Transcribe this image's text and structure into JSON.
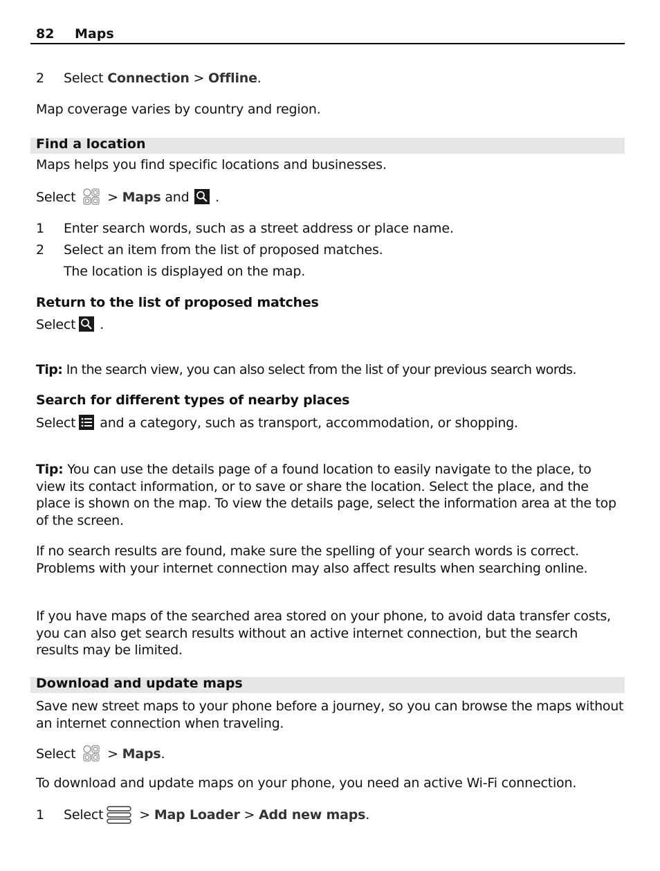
{
  "header": {
    "page_number": "82",
    "chapter": "Maps"
  },
  "step_offline": {
    "num": "2",
    "select": "Select",
    "item1": "Connection",
    "sep": " > ",
    "item2": "Offline",
    "end": "."
  },
  "coverage": "Map coverage varies by country and region.",
  "find_location": {
    "heading": "Find a location",
    "intro": "Maps helps you find specific locations and businesses.",
    "select_line": {
      "select": "Select",
      "sep": " > ",
      "maps": "Maps",
      "and": " and ",
      "end": " ."
    },
    "steps": [
      {
        "num": "1",
        "text": "Enter search words, such as a street address or place name."
      },
      {
        "num": "2",
        "text": "Select an item from the list of proposed matches."
      }
    ],
    "step_note": "The location is displayed on the map.",
    "return_heading": "Return to the list of proposed matches",
    "return_select": "Select",
    "return_end": " .",
    "tip1_label": "Tip:",
    "tip1_text": " In the search view, you can also select from the list of your previous search words.",
    "nearby_heading": "Search for different types of nearby places",
    "nearby_select": "Select",
    "nearby_text": " and a category, such as transport, accommodation, or shopping.",
    "tip2_label": "Tip:",
    "tip2_text": " You can use the details page of a found location to easily navigate to the place, to view its contact information, or to save or share the location. Select the place, and the place is shown on the map. To view the details page, select the information area at the top of the screen.",
    "no_results": "If no search results are found, make sure the spelling of your search words is correct. Problems with your internet connection may also affect results when searching online.",
    "stored_maps": "If you have maps of the searched area stored on your phone, to avoid data transfer costs, you can also get search results without an active internet connection, but the search results may be limited."
  },
  "download": {
    "heading": "Download and update maps",
    "intro": "Save new street maps to your phone before a journey, so you can browse the maps without an internet connection when traveling.",
    "select_line": {
      "select": "Select",
      "sep": " > ",
      "maps": "Maps",
      "end": "."
    },
    "wifi": "To download and update maps on your phone, you need an active Wi-Fi connection.",
    "step1": {
      "num": "1",
      "select": "Select",
      "sep1": " > ",
      "item1": "Map Loader",
      "sep2": "  > ",
      "item2": "Add new maps",
      "end": "."
    }
  }
}
